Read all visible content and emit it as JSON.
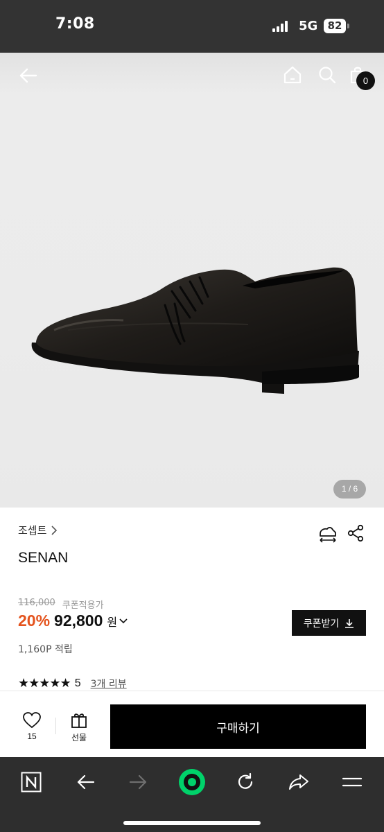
{
  "status_bar": {
    "time": "7:08",
    "network": "5G",
    "battery": "82"
  },
  "header": {
    "cart_count": "0"
  },
  "gallery": {
    "pager": "1 / 6"
  },
  "product": {
    "brand": "조셉트",
    "name": "SENAN",
    "original_price": "116,000",
    "coupon_note": "쿠폰적용가",
    "discount": "20%",
    "sale_price": "92,800",
    "currency": "원",
    "coupon_button": "쿠폰받기",
    "points": "1,160P 적립",
    "rating": "5",
    "rating_stars": 5,
    "review_link": "3개 리뷰"
  },
  "actions": {
    "like_count": "15",
    "gift_label": "선물",
    "buy_label": "구매하기"
  },
  "colors": {
    "accent_discount": "#e4531d",
    "button": "#111111",
    "browser_accent": "#00d26a"
  }
}
